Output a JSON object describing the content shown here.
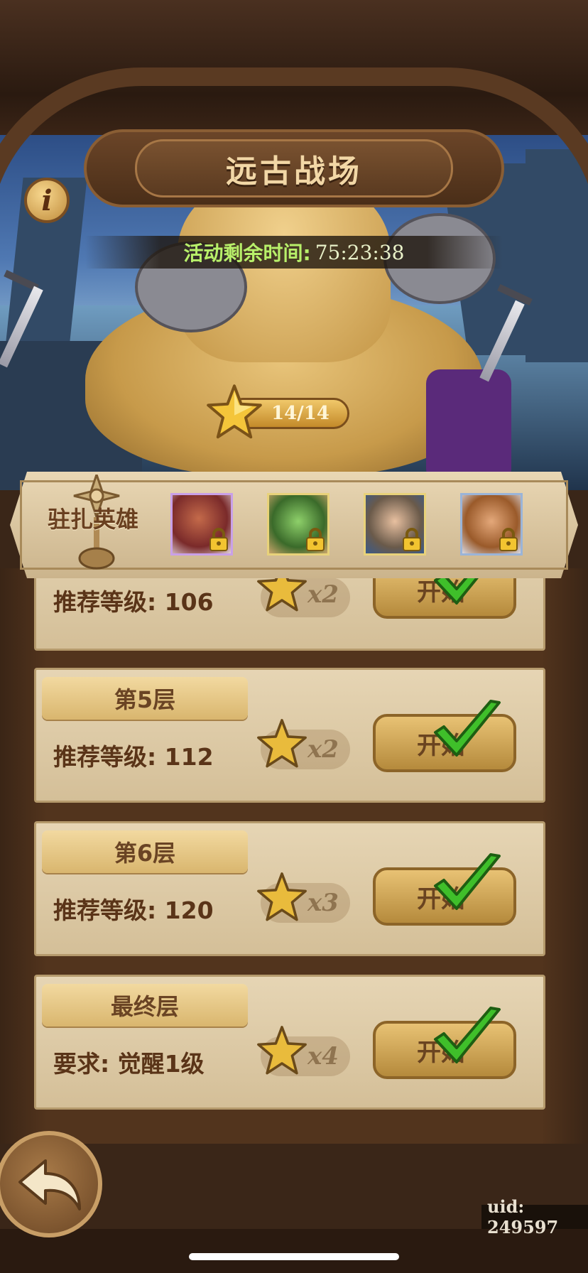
{
  "header": {
    "title": "远古战场",
    "info_icon": "info-icon",
    "timer_label": "活动剩余时间:",
    "timer_value": "75:23:38"
  },
  "progress": {
    "text": "14/14",
    "icon": "star-icon"
  },
  "heroes": {
    "label": "驻扎英雄",
    "slots": [
      {
        "name": "red-haired-elf",
        "locked": true,
        "border": "#c9a0e8"
      },
      {
        "name": "green-goblin",
        "locked": true,
        "border": "#e8d27a"
      },
      {
        "name": "goggles-boy",
        "locked": true,
        "border": "#e8d27a"
      },
      {
        "name": "bearded-warrior",
        "locked": true,
        "border": "#9ab4d8"
      }
    ]
  },
  "floors": [
    {
      "tag": "",
      "requirement": "推荐等级: 106",
      "stars": "x2",
      "button": "开始",
      "completed": true
    },
    {
      "tag": "第5层",
      "requirement": "推荐等级: 112",
      "stars": "x2",
      "button": "开始",
      "completed": true
    },
    {
      "tag": "第6层",
      "requirement": "推荐等级: 120",
      "stars": "x3",
      "button": "开始",
      "completed": true
    },
    {
      "tag": "最终层",
      "requirement": "要求: 觉醒1级",
      "stars": "x4",
      "button": "开始",
      "completed": true
    }
  ],
  "footer": {
    "uid": "uid: 249597",
    "back_icon": "back-arrow-icon"
  },
  "colors": {
    "accent_green": "#b8f06a",
    "gold": "#e8c274",
    "check_green": "#3fbf2a"
  }
}
